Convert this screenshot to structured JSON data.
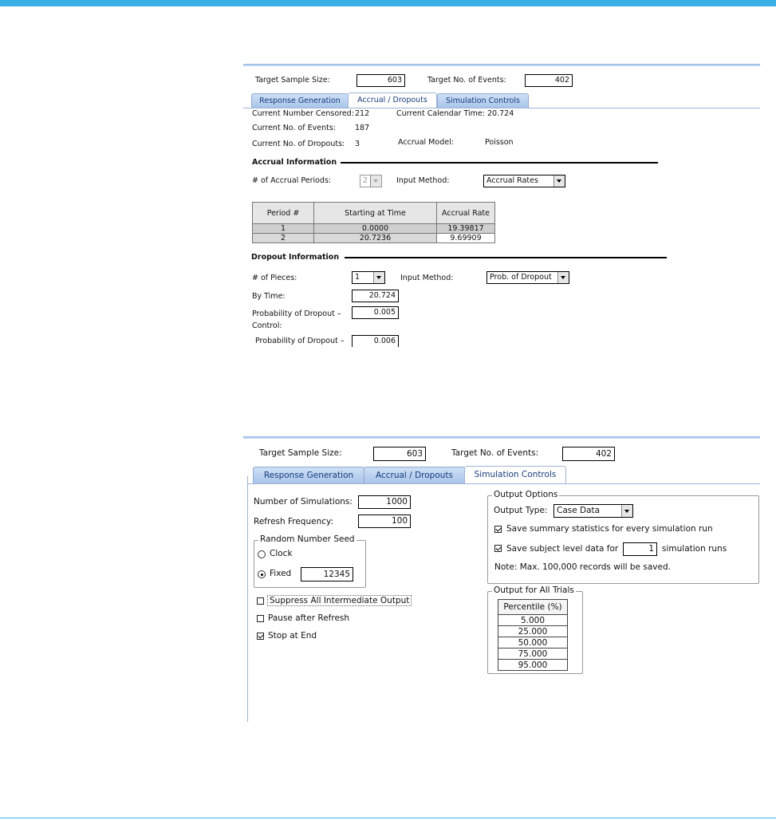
{
  "panel1": {
    "target_sample_size_label": "Target Sample Size:",
    "target_sample_size": "603",
    "target_events_label": "Target No. of Events:",
    "target_events": "402",
    "tabs": [
      "Response Generation",
      "Accrual / Dropouts",
      "Simulation Controls"
    ],
    "current_censored_label": "Current Number Censored:",
    "current_censored": "212",
    "current_calendar_label": "Current Calendar Time:",
    "current_calendar": "20.724",
    "current_events_label": "Current No. of Events:",
    "current_events": "187",
    "current_dropouts_label": "Current No. of Dropouts:",
    "current_dropouts": "3",
    "accrual_model_label": "Accrual Model:",
    "accrual_model": "Poisson",
    "accrual_heading": "Accrual Information",
    "accrual_periods_label": "# of Accrual Periods:",
    "accrual_periods": "2",
    "input_method_label": "Input Method:",
    "accrual_input_method": "Accrual Rates",
    "table_headers": [
      "Period #",
      "Starting at Time",
      "Accrual Rate"
    ],
    "table_rows": [
      [
        "1",
        "0.0000",
        "19.39817"
      ],
      [
        "2",
        "20.7236",
        "9.69909"
      ]
    ],
    "dropout_heading": "Dropout Information",
    "pieces_label": "# of Pieces:",
    "pieces": "1",
    "dropout_input_method_label": "Input Method:",
    "dropout_input_method": "Prob. of Dropout",
    "by_time_label": "By Time:",
    "by_time": "20.724",
    "prob_control_label_1": "Probability of Dropout –",
    "prob_control_label_2": "Control:",
    "prob_control": "0.005",
    "prob_treatment_label": "Probability of Dropout –",
    "prob_treatment": "0.006"
  },
  "panel2": {
    "target_sample_size_label": "Target Sample Size:",
    "target_sample_size": "603",
    "target_events_label": "Target No. of Events:",
    "target_events": "402",
    "tabs": [
      "Response Generation",
      "Accrual / Dropouts",
      "Simulation Controls"
    ],
    "num_simulations_label": "Number of Simulations:",
    "num_simulations": "1000",
    "refresh_label": "Refresh Frequency:",
    "refresh": "100",
    "seed_group": "Random Number Seed",
    "clock_label": "Clock",
    "fixed_label": "Fixed",
    "fixed_value": "12345",
    "suppress_label": "Suppress All Intermediate Output",
    "pause_label": "Pause after Refresh",
    "stop_label": "Stop at End",
    "output_options_group": "Output Options",
    "output_type_label": "Output Type:",
    "output_type": "Case Data",
    "save_summary_label": "Save summary statistics for every simulation run",
    "save_subject_label": "Save subject level data for",
    "save_subject_runs": "1",
    "simulation_runs_label": "simulation runs",
    "note": "Note: Max. 100,000 records will be saved.",
    "all_trials_group": "Output for All Trials",
    "percentile_header": "Percentile (%)",
    "percentiles": [
      "5.000",
      "25.000",
      "50.000",
      "75.000",
      "95.000"
    ]
  }
}
